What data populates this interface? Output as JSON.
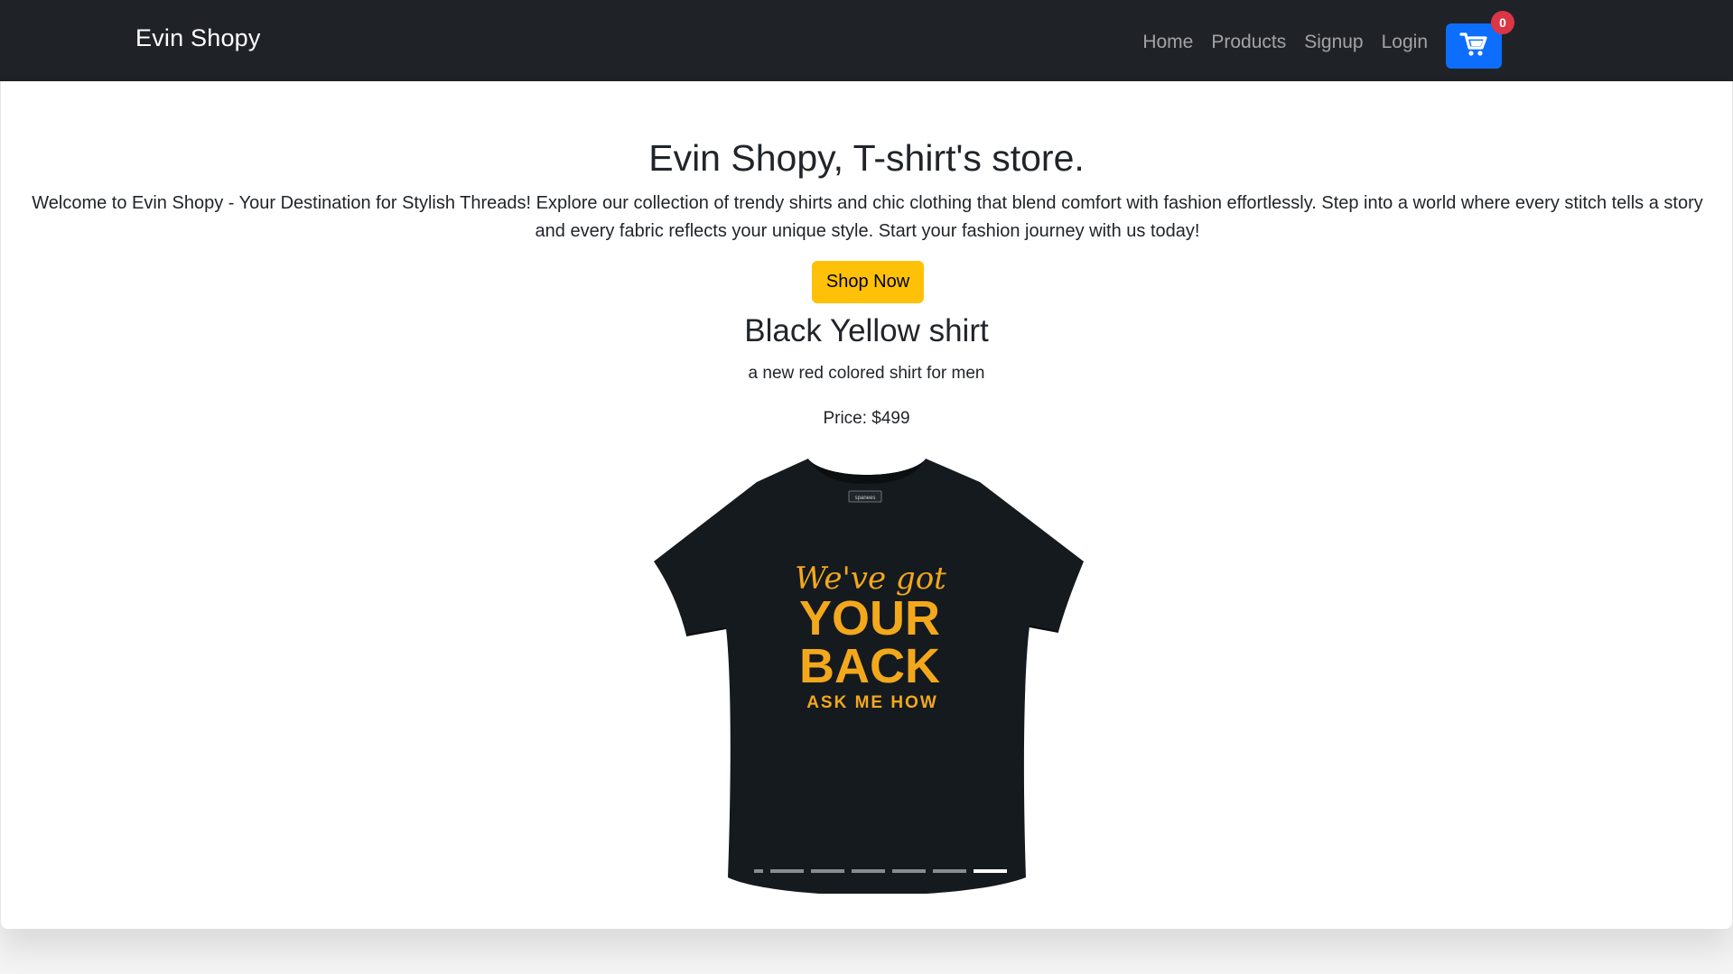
{
  "navbar": {
    "brand": "Evin Shopy",
    "links": [
      "Home",
      "Products",
      "Signup",
      "Login"
    ],
    "cart_count": "0"
  },
  "hero": {
    "title": "Evin Shopy, T-shirt's store.",
    "description": "Welcome to Evin Shopy - Your Destination for Stylish Threads! Explore our collection of trendy shirts and chic clothing that blend comfort with fashion effortlessly. Step into a world where every stitch tells a story and every fabric reflects your unique style. Start your fashion journey with us today!",
    "cta_label": "Shop Now"
  },
  "product": {
    "name": "Black Yellow shirt",
    "description": "a new red colored shirt for men",
    "price": "Price: $499",
    "shirt_print": {
      "line1": "We've got",
      "line2": "YOUR",
      "line3": "BACK",
      "line4": "ASK ME HOW",
      "tag": "spanees"
    }
  },
  "carousel": {
    "slide_count": 7,
    "active_index": 6
  },
  "colors": {
    "navbar_bg": "#1f2327",
    "cart_button": "#0d6efd",
    "badge": "#dc3545",
    "cta": "#ffc107",
    "shirt": "#151a1f",
    "print": "#f3a81c"
  },
  "icons": {
    "cart": "shopping-cart-icon"
  }
}
